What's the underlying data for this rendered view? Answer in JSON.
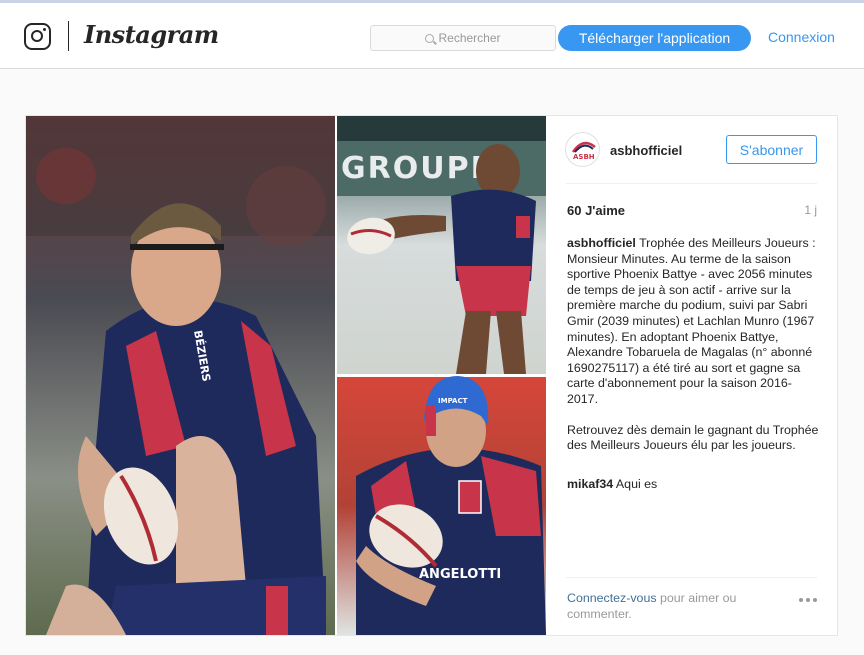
{
  "header": {
    "brand": "Instagram",
    "search_placeholder": "Rechercher",
    "download_label": "Télécharger l'application",
    "login_label": "Connexion",
    "icons": {
      "logo": "camera-glyph-icon",
      "search": "search-icon"
    }
  },
  "post": {
    "images": {
      "left_jersey_text": "BÉZIERS",
      "banner_text": "GROUPE",
      "bottom_sponsor": "ANGELOTTI",
      "helmet_text": "IMPACT"
    },
    "author": {
      "username": "asbhofficiel",
      "avatar_text": "ASBH"
    },
    "follow_label": "S'abonner",
    "likes": "60 J'aime",
    "time": "1 j",
    "caption": {
      "username": "asbhofficiel",
      "text": "Trophée des Meilleurs Joueurs : Monsieur Minutes. Au terme de la saison sportive Phoenix Battye - avec 2056 minutes de temps de jeu à son actif - arrive sur la première marche du podium, suivi par Sabri Gmir (2039 minutes) et Lachlan Munro (1967 minutes). En adoptant Phoenix Battye, Alexandre Tobaruela de Magalas (n° abonné 1690275117) a été tiré au sort et gagne sa carte d'abonnement pour la saison 2016-2017.",
      "text2": "Retrouvez dès demain le gagnant du Trophée des Meilleurs Joueurs élu par les joueurs."
    },
    "comments": [
      {
        "username": "mikaf34",
        "text": "Aqui es"
      }
    ],
    "footer": {
      "login_link": "Connectez-vous",
      "rest": " pour aimer ou commenter."
    }
  },
  "colors": {
    "accent": "#3897f0",
    "jersey_navy": "#1f2a5c",
    "jersey_red": "#c8344a"
  }
}
